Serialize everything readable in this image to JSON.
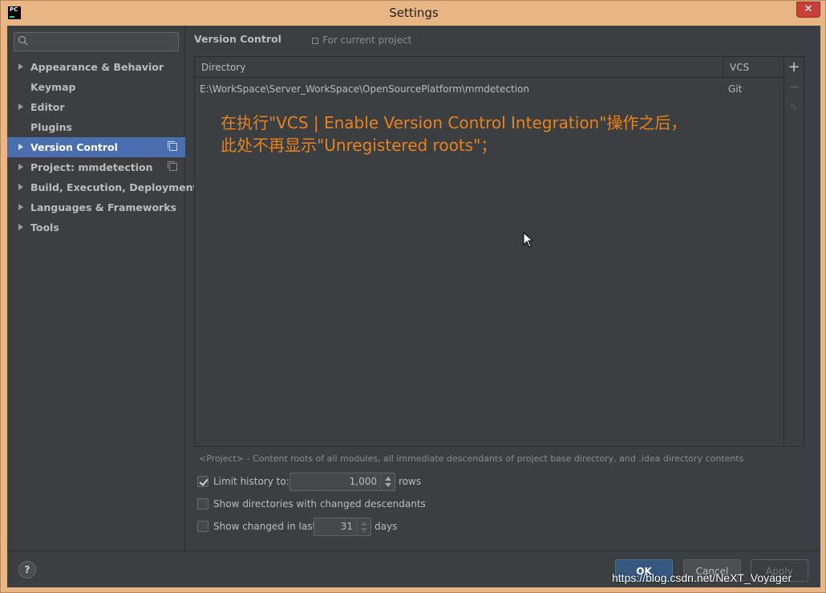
{
  "window": {
    "title": "Settings",
    "app_icon": "PC",
    "close_icon": "✕"
  },
  "sidebar": {
    "search_placeholder": "",
    "items": [
      {
        "label": "Appearance & Behavior",
        "expandable": true
      },
      {
        "label": "Keymap",
        "expandable": false
      },
      {
        "label": "Editor",
        "expandable": true
      },
      {
        "label": "Plugins",
        "expandable": false
      },
      {
        "label": "Version Control",
        "expandable": true,
        "selected": true,
        "project_scoped": true
      },
      {
        "label": "Project: mmdetection",
        "expandable": true,
        "project_scoped": true
      },
      {
        "label": "Build, Execution, Deployment",
        "expandable": true
      },
      {
        "label": "Languages & Frameworks",
        "expandable": true
      },
      {
        "label": "Tools",
        "expandable": true
      }
    ]
  },
  "main": {
    "title": "Version Control",
    "scope_hint": "For current project",
    "table": {
      "headers": [
        "Directory",
        "VCS"
      ],
      "rows": [
        {
          "directory": "E:\\WorkSpace\\Server_WorkSpace\\OpenSourcePlatform\\mmdetection",
          "vcs": "Git"
        }
      ]
    },
    "annotation_line1": "在执行\"VCS | Enable Version Control Integration\"操作之后，",
    "annotation_line2": "此处不再显示\"Unregistered roots\"；",
    "toolbar": {
      "add": "+",
      "remove": "−",
      "edit": "✎"
    },
    "footnote": "<Project> - Content roots of all modules, all immediate descendants of project base directory, and .idea directory contents",
    "options": {
      "limit_history": {
        "label": "Limit history to:",
        "checked": true,
        "value": "1,000",
        "unit": "rows"
      },
      "show_dirs": {
        "label": "Show directories with changed descendants",
        "checked": false
      },
      "show_changed": {
        "label": "Show changed in last",
        "checked": false,
        "value": "31",
        "unit": "days"
      }
    }
  },
  "buttons": {
    "help": "?",
    "ok": "OK",
    "cancel": "Cancel",
    "apply": "Apply"
  },
  "watermark": "https://blog.csdn.net/NeXT_Voyager",
  "colors": {
    "accent_selection": "#4b6eaf",
    "panel_bg": "#3c3f41",
    "annotation": "#e8821e"
  }
}
